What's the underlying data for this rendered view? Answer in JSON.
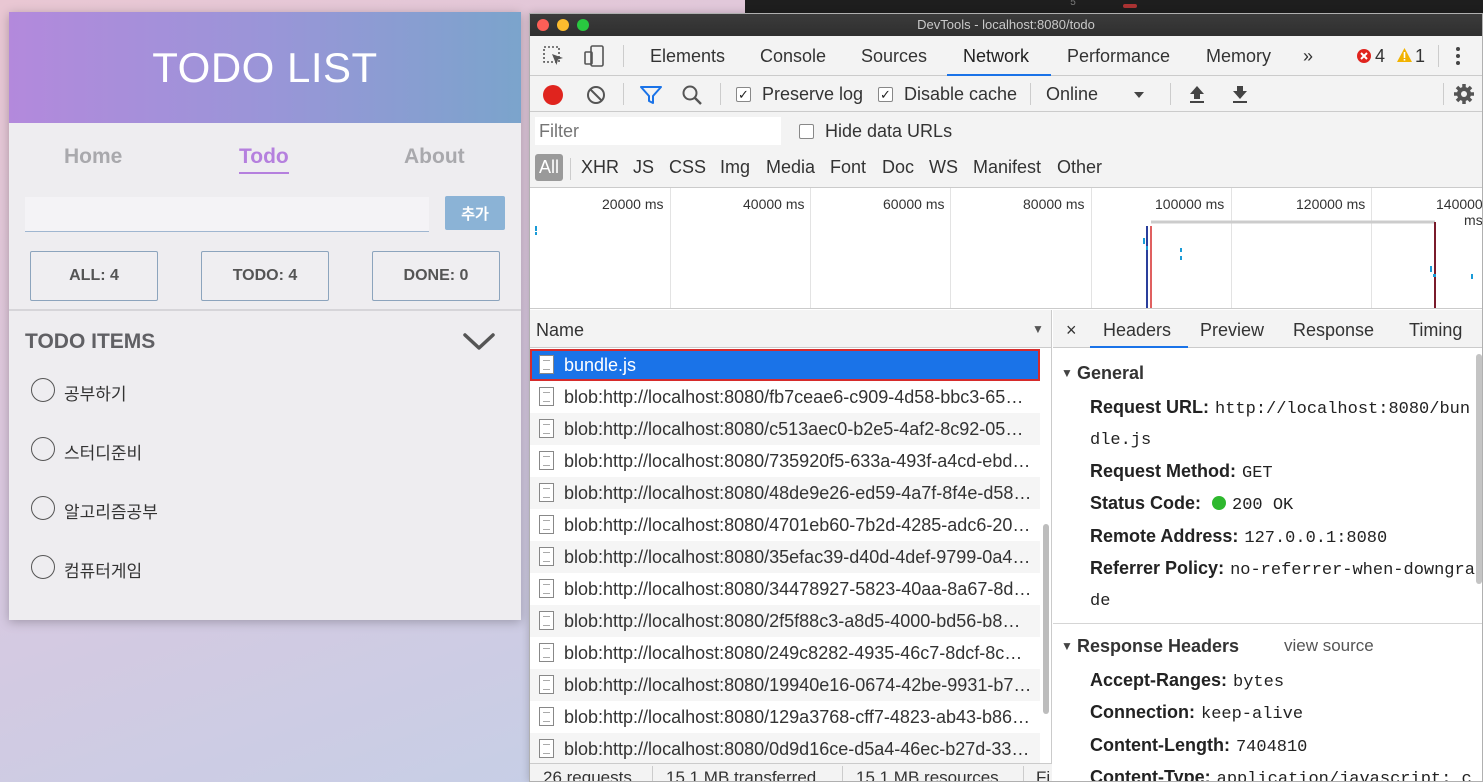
{
  "app": {
    "title": "TODO LIST",
    "nav": {
      "home": "Home",
      "todo": "Todo",
      "about": "About"
    },
    "input_value": "",
    "add_button": "추가",
    "filters": {
      "all": "ALL: 4",
      "todo": "TODO: 4",
      "done": "DONE: 0"
    },
    "items_title": "TODO ITEMS",
    "items": [
      {
        "text": "공부하기"
      },
      {
        "text": "스터디준비"
      },
      {
        "text": "알고리즘공부"
      },
      {
        "text": "컴퓨터게임"
      }
    ]
  },
  "background_editor": {
    "line_number": "5"
  },
  "devtools": {
    "window_title": "DevTools - localhost:8080/todo",
    "tabs": [
      "Elements",
      "Console",
      "Sources",
      "Network",
      "Performance",
      "Memory",
      "»"
    ],
    "active_tab": "Network",
    "errors": "4",
    "warnings": "1",
    "toolbar": {
      "preserve_log": "Preserve log",
      "disable_cache": "Disable cache",
      "throttle": "Online"
    },
    "filter": {
      "placeholder": "Filter",
      "hide_data_urls": "Hide data URLs",
      "types": [
        "All",
        "XHR",
        "JS",
        "CSS",
        "Img",
        "Media",
        "Font",
        "Doc",
        "WS",
        "Manifest",
        "Other"
      ]
    },
    "timeline_labels": [
      "20000 ms",
      "40000 ms",
      "60000 ms",
      "80000 ms",
      "100000 ms",
      "120000 ms",
      "140000 ms"
    ],
    "name_column": "Name",
    "requests": [
      "bundle.js",
      "blob:http://localhost:8080/fb7ceae6-c909-4d58-bbc3-65…",
      "blob:http://localhost:8080/c513aec0-b2e5-4af2-8c92-05…",
      "blob:http://localhost:8080/735920f5-633a-493f-a4cd-ebd…",
      "blob:http://localhost:8080/48de9e26-ed59-4a7f-8f4e-d58…",
      "blob:http://localhost:8080/4701eb60-7b2d-4285-adc6-20…",
      "blob:http://localhost:8080/35efac39-d40d-4def-9799-0a4…",
      "blob:http://localhost:8080/34478927-5823-40aa-8a67-8d…",
      "blob:http://localhost:8080/2f5f88c3-a8d5-4000-bd56-b8…",
      "blob:http://localhost:8080/249c8282-4935-46c7-8dcf-8c…",
      "blob:http://localhost:8080/19940e16-0674-42be-9931-b7…",
      "blob:http://localhost:8080/129a3768-cff7-4823-ab43-b86…",
      "blob:http://localhost:8080/0d9d16ce-d5a4-46ec-b27d-33…"
    ],
    "selected_request": "bundle.js",
    "status": {
      "requests": "26 requests",
      "transferred": "15.1 MB transferred",
      "resources": "15.1 MB resources",
      "finish": "Fi"
    },
    "detail_tabs": {
      "close": "×",
      "headers": "Headers",
      "preview": "Preview",
      "response": "Response",
      "timing": "Timing"
    },
    "general": {
      "title": "General",
      "request_url_key": "Request URL:",
      "request_url_line1": "http://localhost:8080/bun",
      "request_url_line2": "dle.js",
      "request_method_key": "Request Method:",
      "request_method": "GET",
      "status_code_key": "Status Code:",
      "status_code": "200 OK",
      "remote_address_key": "Remote Address:",
      "remote_address": "127.0.0.1:8080",
      "referrer_policy_key": "Referrer Policy:",
      "referrer_policy_line1": "no-referrer-when-downgra",
      "referrer_policy_line2": "de"
    },
    "response_headers": {
      "title": "Response Headers",
      "view_source": "view source",
      "accept_ranges_key": "Accept-Ranges:",
      "accept_ranges": "bytes",
      "connection_key": "Connection:",
      "connection": "keep-alive",
      "content_length_key": "Content-Length:",
      "content_length": "7404810",
      "content_type_key": "Content-Type:",
      "content_type": "application/javascript; c"
    },
    "colors": {
      "accent": "#1a73e8",
      "record": "#e0241e",
      "status_ok": "#2eb82e"
    }
  }
}
